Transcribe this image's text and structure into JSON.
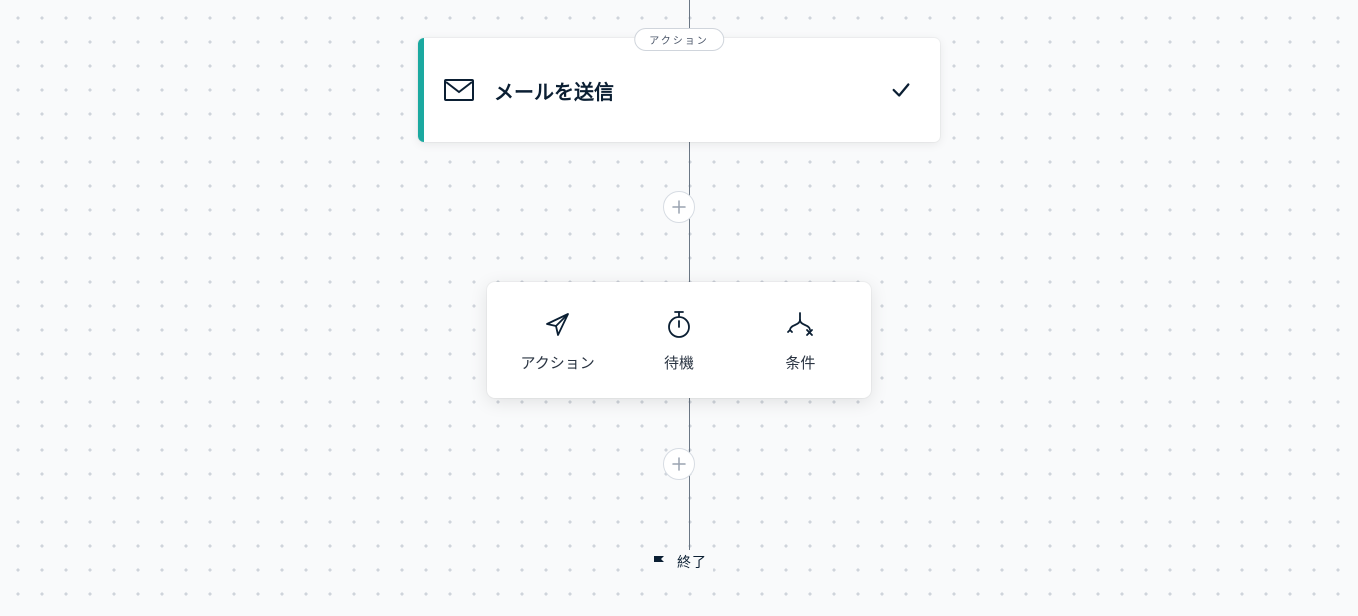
{
  "workflow": {
    "node_badge": "アクション",
    "node_title": "メールを送信",
    "end_label": "終了"
  },
  "options": {
    "action": "アクション",
    "wait": "待機",
    "condition": "条件"
  },
  "icons": {
    "mail": "mail-icon",
    "check": "check-icon",
    "plus": "plus-icon",
    "send": "paper-plane-icon",
    "timer": "stopwatch-icon",
    "branch": "branch-icon",
    "flag": "flag-icon"
  }
}
